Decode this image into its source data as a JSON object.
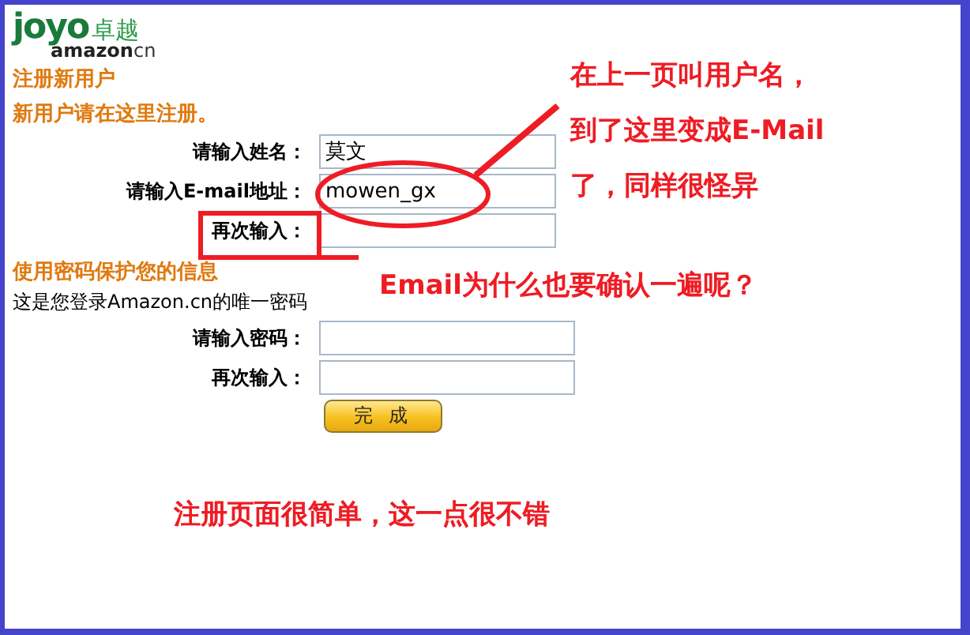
{
  "logo": {
    "brand": "joyo",
    "brand_cn": "卓越",
    "domain": "amazon",
    "domain_suffix": "cn"
  },
  "heading": "注册新用户",
  "subheading": "新用户请在这里注册。",
  "account_fields": [
    {
      "label": "请输入姓名：",
      "value": "莫文"
    },
    {
      "label": "请输入E-mail地址：",
      "value": "mowen_gx"
    },
    {
      "label": "再次输入："
    }
  ],
  "password_section": {
    "heading": "使用密码保护您的信息",
    "note": "这是您登录Amazon.cn的唯一密码"
  },
  "password_fields": [
    {
      "label": "请输入密码："
    },
    {
      "label": "再次输入："
    }
  ],
  "submit_button": "完 成",
  "annotations": [
    {
      "kind": "multiline",
      "lines": [
        "在上一页叫用户名，",
        "到了这里变成E-Mail",
        "了，同样很怪异"
      ]
    },
    {
      "kind": "line",
      "text": "Email为什么也要确认一遍呢？"
    },
    {
      "kind": "line",
      "text": "注册页面很简单，这一点很不错"
    }
  ]
}
